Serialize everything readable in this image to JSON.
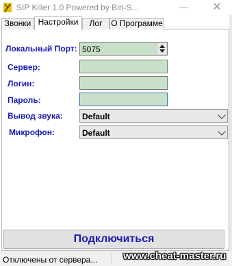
{
  "window": {
    "title": "SIP Killer 1.0 Powered by Bin-S...",
    "minimize": "—",
    "close": "✕"
  },
  "tabs": [
    {
      "label": "Звонки"
    },
    {
      "label": "Настройки"
    },
    {
      "label": "Лог"
    },
    {
      "label": "О Программе"
    }
  ],
  "active_tab": "Настройки",
  "form": {
    "port_label": "Локальный Порт:",
    "port_value": "5075",
    "server_label": "Сервер:",
    "server_value": "",
    "login_label": "Логин:",
    "login_value": "",
    "password_label": "Пароль:",
    "password_value": "",
    "audio_out_label": "Вывод звука:",
    "audio_out_value": "Default",
    "mic_label": "Микрофон:",
    "mic_value": "Default"
  },
  "connect_button": "Подключиться",
  "status": {
    "text": "Отключены от сервера..."
  },
  "watermark": "www.cheat-master.ru",
  "colors": {
    "label_blue": "#1a1ab0",
    "field_green": "#c8e0c8",
    "focus_blue": "#2f6fd0"
  },
  "icons": {
    "app": "sip-killer-app-icon",
    "spin": "spinner-arrows-icon",
    "dropdown": "chevron-down-icon"
  }
}
